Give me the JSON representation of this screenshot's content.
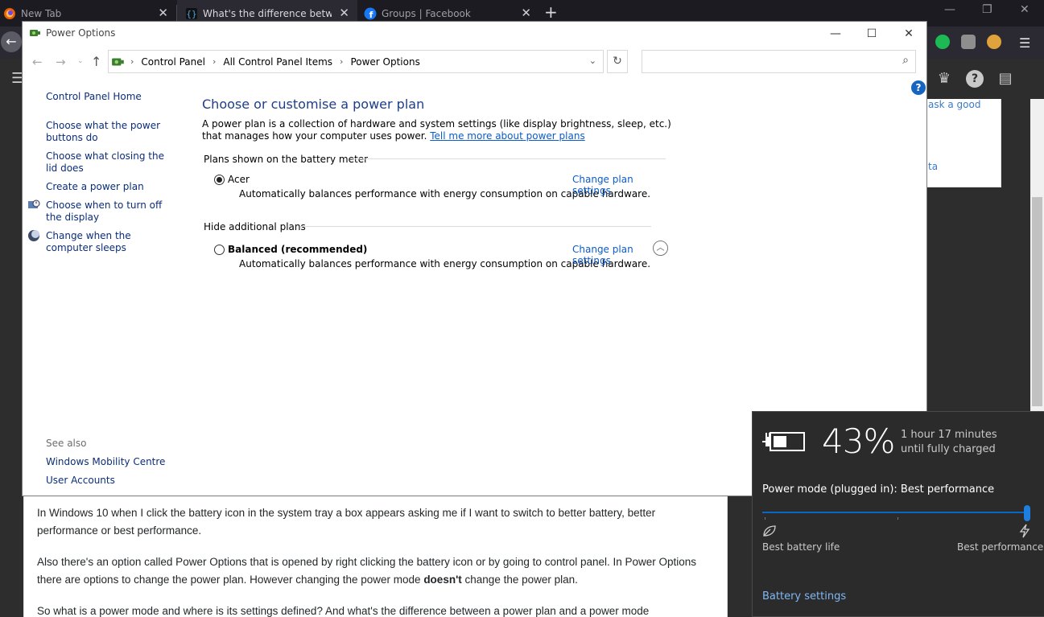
{
  "browser": {
    "tabs": [
      {
        "title": "New Tab",
        "icon": "firefox-icon"
      },
      {
        "title": "What's the difference between",
        "icon": "brackets-icon"
      },
      {
        "title": "Groups | Facebook",
        "icon": "facebook-icon"
      }
    ],
    "new_tab_glyph": "+",
    "site_snippets": {
      "ask": "ask a good",
      "ta": "ta"
    }
  },
  "question": {
    "p1": "In Windows 10 when I click the battery icon in the system tray a box appears asking me if I want to switch to better battery, better performance or best performance.",
    "p2_a": "Also there's an option called Power Options that is opened by right clicking the battery icon or by going to control panel. In Power Options there are options to change the power plan. However changing the power mode ",
    "p2_b": "doesn't",
    "p2_c": " change the power plan.",
    "p3": "So what is a power mode and where is its settings defined? And what's the difference between a power plan and a power mode"
  },
  "window": {
    "title": "Power Options",
    "breadcrumbs": [
      "Control Panel",
      "All Control Panel Items",
      "Power Options"
    ],
    "search_placeholder": "",
    "help": "?"
  },
  "sidebar": {
    "home": "Control Panel Home",
    "items": [
      {
        "label": "Choose what the power buttons do"
      },
      {
        "label": "Choose what closing the lid does"
      },
      {
        "label": "Create a power plan"
      },
      {
        "label": "Choose when to turn off the display"
      },
      {
        "label": "Change when the computer sleeps"
      }
    ],
    "see_also": "See also",
    "see_also_items": [
      "Windows Mobility Centre",
      "User Accounts"
    ]
  },
  "main": {
    "heading": "Choose or customise a power plan",
    "description": "A power plan is a collection of hardware and system settings (like display brightness, sleep, etc.) that manages how your computer uses power. ",
    "learn_more": "Tell me more about power plans",
    "section_battery": "Plans shown on the battery meter",
    "section_hide": "Hide additional plans",
    "plans": [
      {
        "name": "Acer",
        "desc": "Automatically balances performance with energy consumption on capable hardware.",
        "link": "Change plan settings",
        "selected": true
      },
      {
        "name": "Balanced (recommended)",
        "desc": "Automatically balances performance with energy consumption on capable hardware.",
        "link": "Change plan settings",
        "selected": false
      }
    ]
  },
  "battery_flyout": {
    "percent": "43%",
    "charge_line1": "1 hour 17 minutes",
    "charge_line2": "until fully charged",
    "power_mode": "Power mode (plugged in): Best performance",
    "slider_value": 1.0,
    "label_left": "Best battery life",
    "label_right": "Best performance",
    "settings_link": "Battery settings",
    "accent": "#0a68c4"
  }
}
